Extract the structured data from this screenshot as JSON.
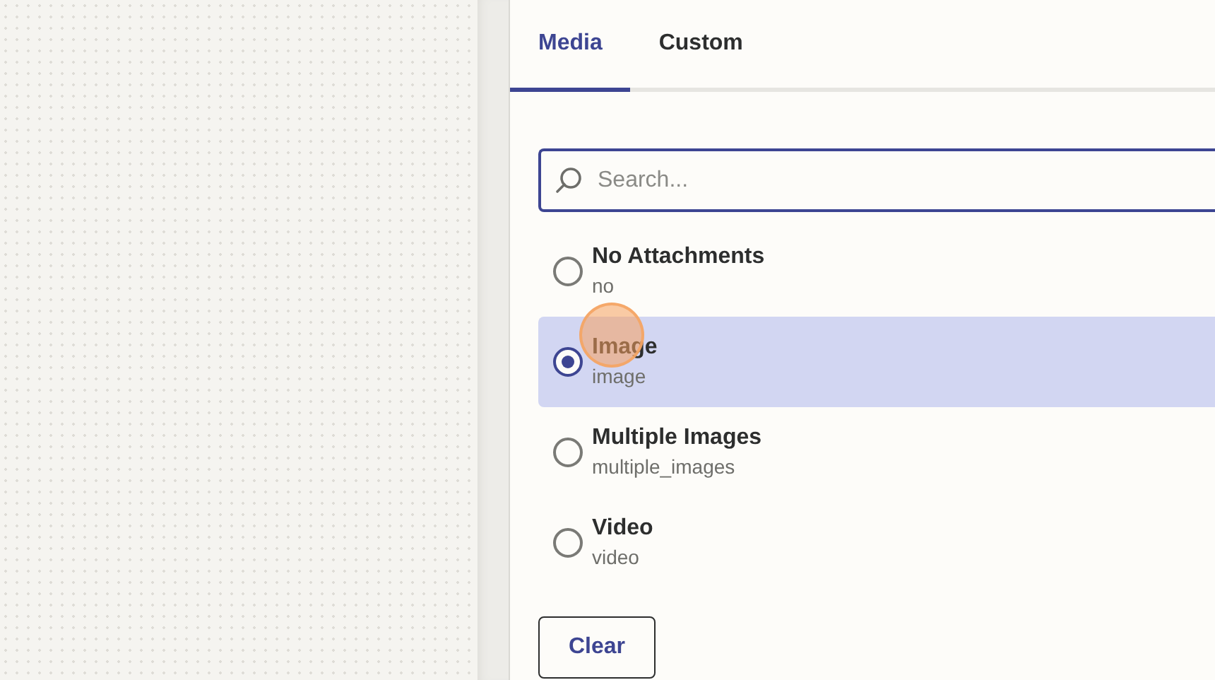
{
  "tabs": [
    {
      "label": "Media",
      "selected": true
    },
    {
      "label": "Custom",
      "selected": false
    }
  ],
  "search": {
    "placeholder": "Search..."
  },
  "options": [
    {
      "label": "No Attachments",
      "value": "no",
      "selected": false
    },
    {
      "label": "Image",
      "value": "image",
      "selected": true
    },
    {
      "label": "Multiple Images",
      "value": "multiple_images",
      "selected": false
    },
    {
      "label": "Video",
      "value": "video",
      "selected": false
    }
  ],
  "clear_button": "Clear"
}
